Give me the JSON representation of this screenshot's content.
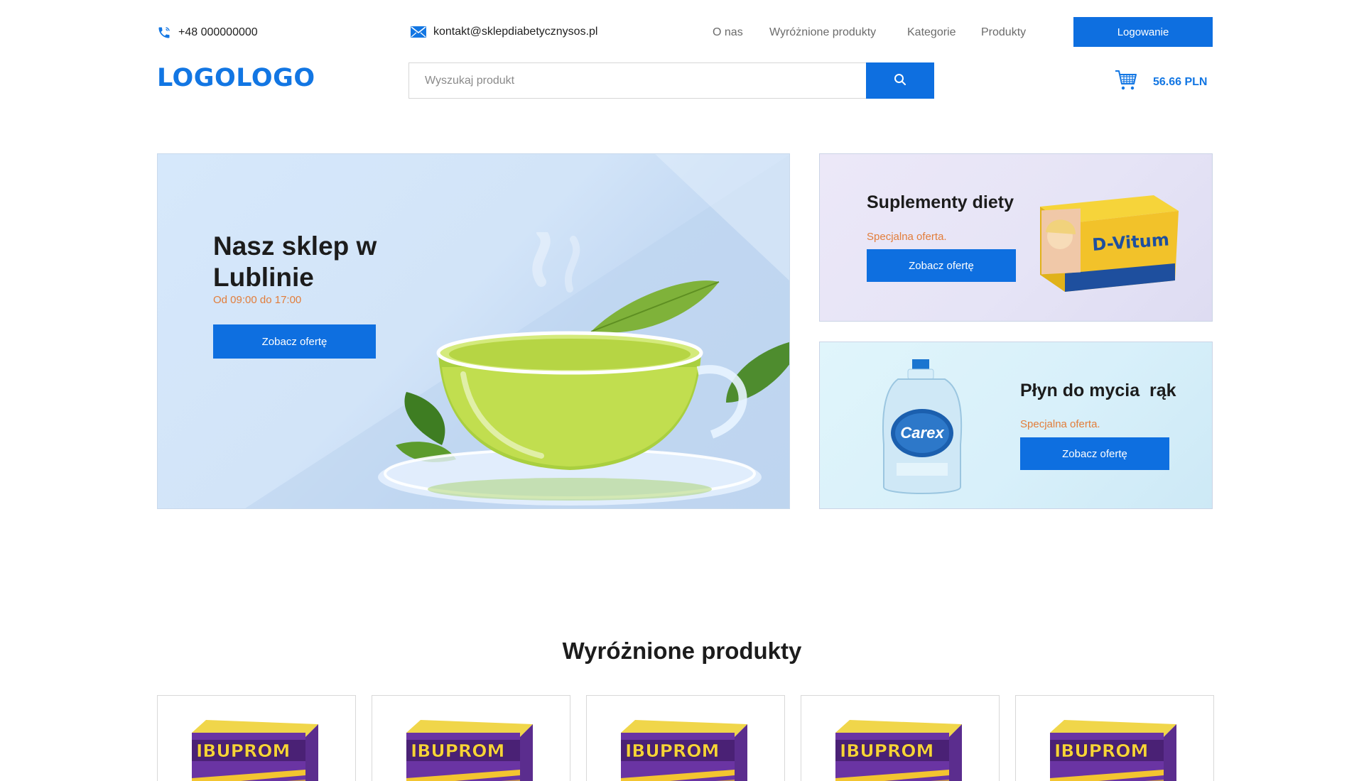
{
  "header": {
    "phone": "+48 000000000",
    "email": "kontakt@sklepdiabetycznysos.pl",
    "nav": [
      "O nas",
      "Wyróżnione produkty",
      "Kategorie",
      "Produkty"
    ],
    "login_label": "Logowanie",
    "logo_text": "LOGOLOGO",
    "search_placeholder": "Wyszukaj produkt",
    "cart_total": "56.66 PLN"
  },
  "hero": {
    "title": "Nasz sklep w Lublinie",
    "hours": "Od 09:00 do 17:00",
    "button_label": "Zobacz ofertę"
  },
  "promos": [
    {
      "title": "Suplementy diety",
      "subtitle": "Specjalna oferta.",
      "button_label": "Zobacz ofertę",
      "product_brand": "D-Vitum"
    },
    {
      "title": "Płyn do mycia  rąk",
      "subtitle": "Specjalna oferta.",
      "button_label": "Zobacz ofertę",
      "product_brand": "Carex"
    }
  ],
  "featured": {
    "title": "Wyróżnione produkty",
    "products": [
      {
        "brand": "IBUPROM"
      },
      {
        "brand": "IBUPROM"
      },
      {
        "brand": "IBUPROM"
      },
      {
        "brand": "IBUPROM"
      },
      {
        "brand": "IBUPROM"
      }
    ]
  },
  "colors": {
    "accent": "#0e6fe0",
    "offer": "#e27d3a"
  },
  "icons": [
    "phone-icon",
    "mail-icon",
    "search-icon",
    "cart-icon"
  ]
}
